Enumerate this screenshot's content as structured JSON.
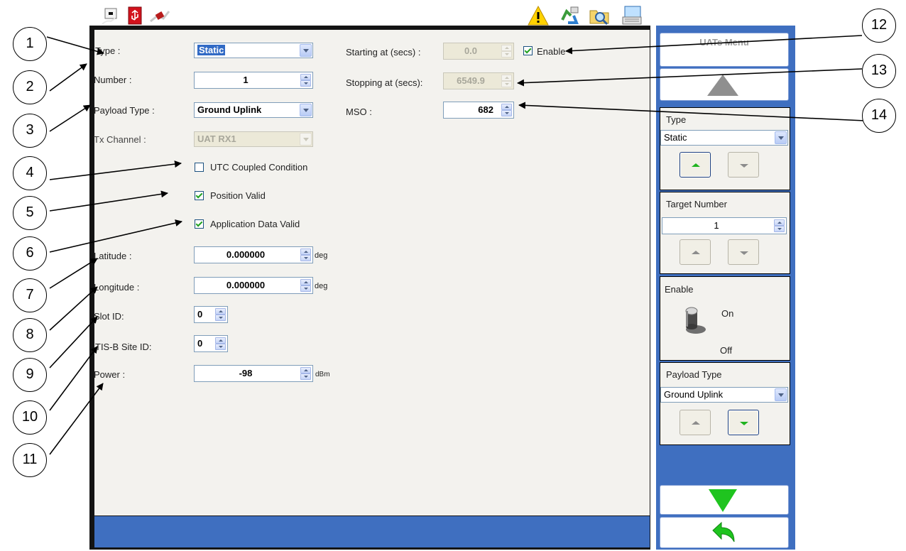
{
  "form": {
    "type_label": "Type :",
    "type_value": "Static",
    "number_label": "Number :",
    "number_value": "1",
    "payload_label": "Payload Type :",
    "payload_value": "Ground Uplink",
    "tx_label": "Tx Channel :",
    "tx_value": "UAT RX1",
    "utc_label": "UTC Coupled Condition",
    "utc_checked": false,
    "posvalid_label": "Position Valid",
    "posvalid_checked": true,
    "appdata_label": "Application Data Valid",
    "appdata_checked": true,
    "lat_label": "Latitude :",
    "lat_value": "0.000000",
    "lat_unit": "deg",
    "lon_label": "Longitude :",
    "lon_value": "0.000000",
    "lon_unit": "deg",
    "slot_label": "Slot  ID:",
    "slot_value": "0",
    "tisb_label": "TIS-B Site ID:",
    "tisb_value": "0",
    "power_label": "Power :",
    "power_value": "-98",
    "power_unit": "dBm",
    "start_label": "Starting at (secs) :",
    "start_value": "0.0",
    "enable_label": "Enable",
    "enable_checked": true,
    "stop_label": "Stopping at (secs):",
    "stop_value": "6549.9",
    "mso_label": "MSO :",
    "mso_value": "682"
  },
  "callouts": [
    "1",
    "2",
    "3",
    "4",
    "5",
    "6",
    "7",
    "8",
    "9",
    "10",
    "11",
    "12",
    "13",
    "14"
  ],
  "side": {
    "menu_title": "UATs Menu",
    "type_title": "Type",
    "type_value": "Static",
    "target_title": "Target Number",
    "target_value": "1",
    "enable_title": "Enable",
    "on_label": "On",
    "off_label": "Off",
    "payload_title": "Payload Type",
    "payload_value": "Ground Uplink"
  },
  "icons": {
    "taskbar": [
      "network-icon",
      "usb-icon",
      "plug-icon",
      "warning-icon",
      "recycle-icon",
      "folder-search-icon",
      "keyboard-icon"
    ]
  },
  "colors": {
    "panel_bg": "#f3f2ee",
    "taskbar_blue": "#3f6fc0",
    "check_green": "#21a121",
    "arrow_green": "#1fc41f"
  }
}
